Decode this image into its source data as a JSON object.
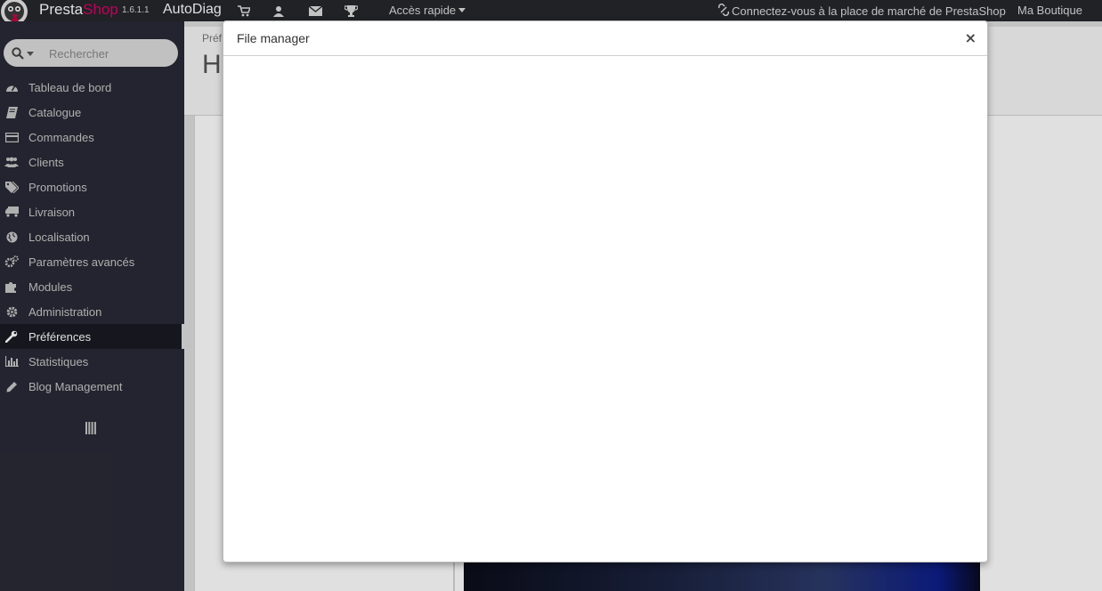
{
  "header": {
    "brand_presta": "Presta",
    "brand_shop": "Shop",
    "version": "1.6.1.1",
    "store_name": "AutoDiag",
    "quick_access": "Accès rapide",
    "marketplace": "Connectez-vous à la place de marché de PrestaShop",
    "my_shop": "Ma Boutique"
  },
  "sidebar": {
    "search_placeholder": "Rechercher",
    "items": [
      {
        "label": "Tableau de bord",
        "icon": "dashboard-icon"
      },
      {
        "label": "Catalogue",
        "icon": "book-icon"
      },
      {
        "label": "Commandes",
        "icon": "credit-card-icon"
      },
      {
        "label": "Clients",
        "icon": "users-icon"
      },
      {
        "label": "Promotions",
        "icon": "tags-icon"
      },
      {
        "label": "Livraison",
        "icon": "truck-icon"
      },
      {
        "label": "Localisation",
        "icon": "globe-icon"
      },
      {
        "label": "Paramètres avancés",
        "icon": "cogs-icon"
      },
      {
        "label": "Modules",
        "icon": "puzzle-icon"
      },
      {
        "label": "Administration",
        "icon": "gear-icon"
      },
      {
        "label": "Préférences",
        "icon": "wrench-icon",
        "active": true
      },
      {
        "label": "Statistiques",
        "icon": "bar-chart-icon"
      },
      {
        "label": "Blog Management",
        "icon": "pencil-icon"
      }
    ]
  },
  "page": {
    "breadcrumb": "Préf",
    "title": "H"
  },
  "modal": {
    "title": "File manager",
    "close": "×"
  },
  "colors": {
    "header_bg": "#25272c",
    "sidebar_bg": "#2a2a37",
    "brand_pink": "#df0067"
  }
}
